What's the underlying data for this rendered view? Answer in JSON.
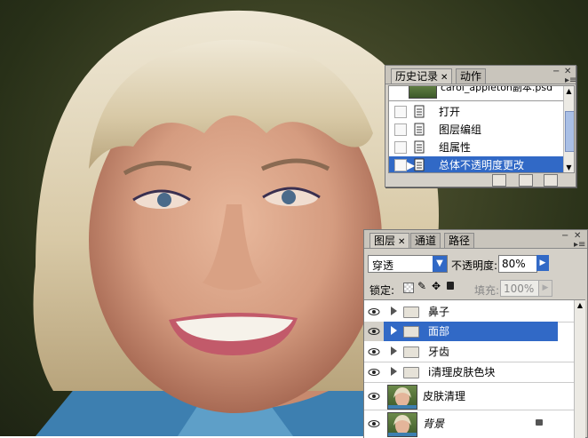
{
  "history_panel": {
    "tabs": [
      {
        "label": "历史记录",
        "active": true
      },
      {
        "label": "动作",
        "active": false
      }
    ],
    "snapshot_name": "carol_appleton副本.psd",
    "items": [
      {
        "label": "打开",
        "selected": false
      },
      {
        "label": "图层编组",
        "selected": false
      },
      {
        "label": "组属性",
        "selected": false
      },
      {
        "label": "总体不透明度更改",
        "selected": true
      }
    ]
  },
  "layers_panel": {
    "tabs": [
      {
        "label": "图层",
        "active": true
      },
      {
        "label": "通道",
        "active": false
      },
      {
        "label": "路径",
        "active": false
      }
    ],
    "blend_mode": "穿透",
    "opacity_label": "不透明度:",
    "opacity_value": "80%",
    "lock_label": "锁定:",
    "fill_label": "填充:",
    "fill_value": "100%",
    "layers": [
      {
        "name": "鼻子",
        "type": "group",
        "selected": false
      },
      {
        "name": "面部",
        "type": "group",
        "selected": true
      },
      {
        "name": "牙齿",
        "type": "group",
        "selected": false
      },
      {
        "name": "i清理皮肤色块",
        "type": "group",
        "selected": false
      },
      {
        "name": "皮肤清理",
        "type": "layer",
        "selected": false
      },
      {
        "name": "背景",
        "type": "layer",
        "selected": false,
        "locked": true
      }
    ]
  },
  "colors": {
    "selection": "#3169c6",
    "panel_bg": "#d4d0c8"
  }
}
